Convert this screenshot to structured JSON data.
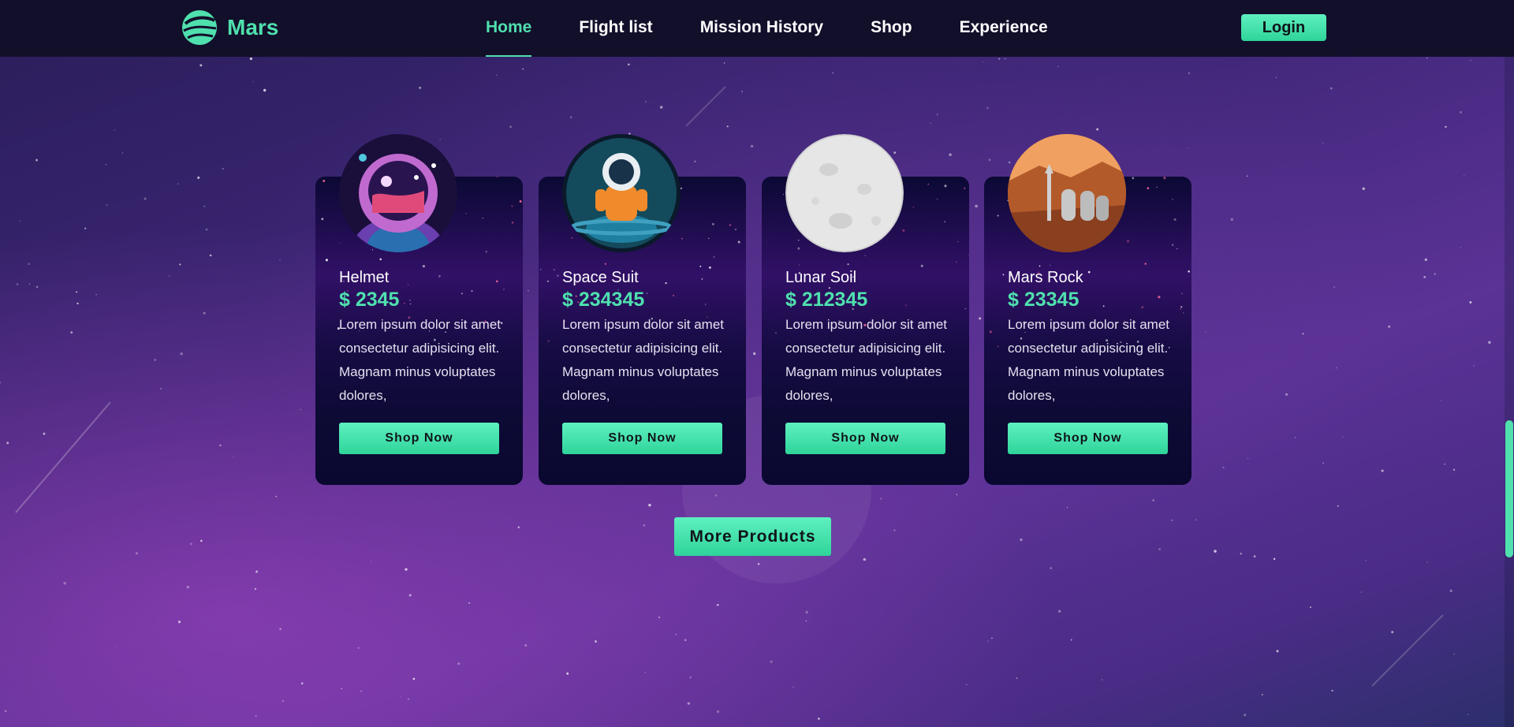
{
  "brand": {
    "name": "Mars",
    "logo_icon": "planet-logo-icon"
  },
  "nav": {
    "items": [
      {
        "label": "Home",
        "active": true
      },
      {
        "label": "Flight list",
        "active": false
      },
      {
        "label": "Mission History",
        "active": false
      },
      {
        "label": "Shop",
        "active": false
      },
      {
        "label": "Experience",
        "active": false
      }
    ],
    "login_label": "Login"
  },
  "products": [
    {
      "name": "Helmet",
      "price": "$ 2345",
      "description": "Lorem ipsum dolor sit amet consectetur adipisicing elit. Magnam minus voluptates dolores,",
      "button_label": "Shop Now",
      "image": "astronaut-helmet-image"
    },
    {
      "name": "Space Suit",
      "price": "$ 234345",
      "description": "Lorem ipsum dolor sit amet consectetur adipisicing elit. Magnam minus voluptates dolores,",
      "button_label": "Shop Now",
      "image": "astronaut-suit-image"
    },
    {
      "name": "Lunar Soil",
      "price": "$ 212345",
      "description": "Lorem ipsum dolor sit amet consectetur adipisicing elit. Magnam minus voluptates dolores,",
      "button_label": "Shop Now",
      "image": "moon-image"
    },
    {
      "name": "Mars Rock",
      "price": "$ 23345",
      "description": "Lorem ipsum dolor sit amet consectetur adipisicing elit. Magnam minus voluptates dolores,",
      "button_label": "Shop Now",
      "image": "mars-base-image"
    }
  ],
  "more_products_label": "More Products",
  "colors": {
    "accent": "#4fe0ae",
    "nav_bg": "#120f2a",
    "card_bg": "#0b0934",
    "bg_purple": "#5b3296"
  }
}
